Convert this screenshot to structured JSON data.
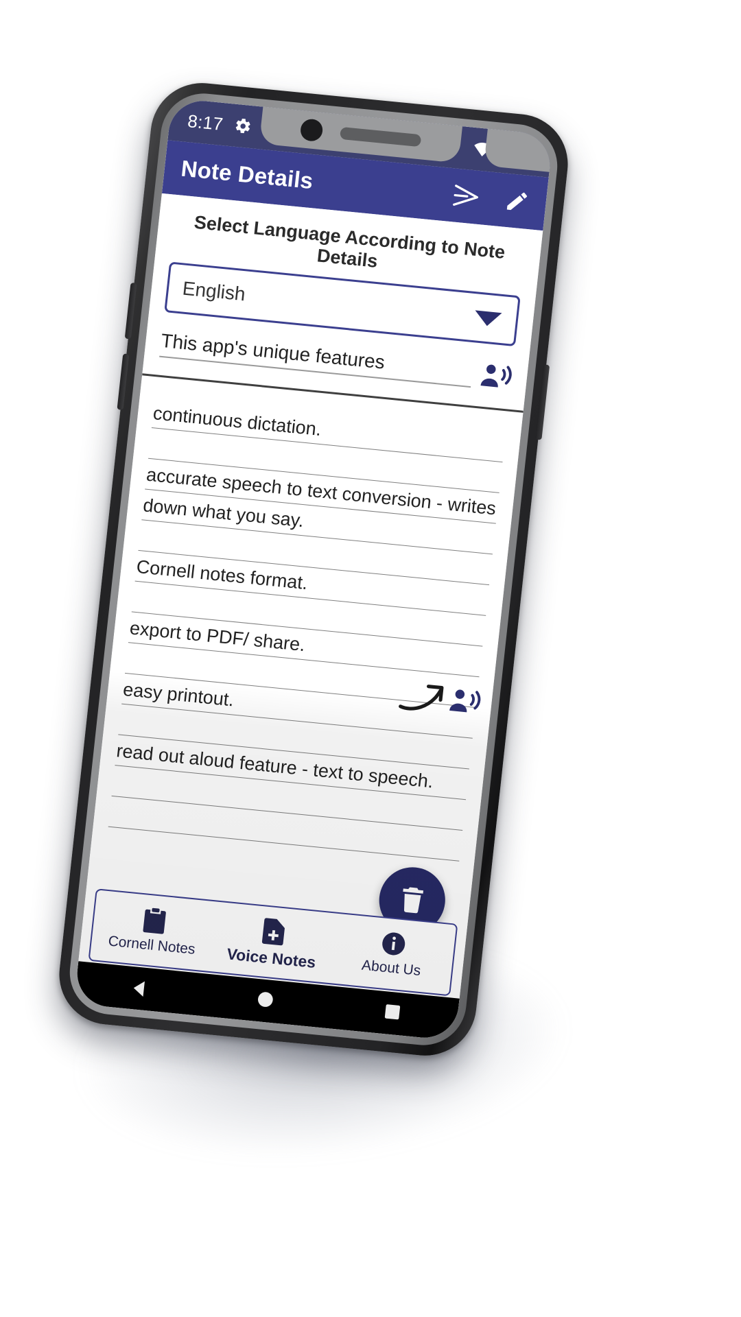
{
  "status_bar": {
    "time": "8:17",
    "left_icons": [
      "gear-icon",
      "sd-card-icon"
    ],
    "right_icons": [
      "wifi-icon",
      "signal-icon",
      "battery-icon"
    ]
  },
  "app_bar": {
    "title": "Note Details",
    "actions": [
      {
        "name": "send-icon",
        "label": "Send"
      },
      {
        "name": "edit-pencil-icon",
        "label": "Edit"
      }
    ]
  },
  "language": {
    "header": "Select Language According to Note Details",
    "selected": "English",
    "caret": "chevron-down-icon"
  },
  "note": {
    "title": "This app's unique features",
    "title_speaker_icon": "speaker-person-icon",
    "lines": [
      {
        "text": "continuous dictation.",
        "blank": false
      },
      {
        "text": "",
        "blank": true
      },
      {
        "text": "accurate speech to text conversion - writes",
        "blank": false
      },
      {
        "text": "down what you say.",
        "blank": false
      },
      {
        "text": "",
        "blank": true
      },
      {
        "text": "Cornell notes format.",
        "blank": false
      },
      {
        "text": "",
        "blank": true
      },
      {
        "text": "export to PDF/ share.",
        "blank": false
      },
      {
        "text": "",
        "blank": true
      },
      {
        "text": "easy printout.",
        "blank": false
      },
      {
        "text": "",
        "blank": true
      },
      {
        "text": "read out aloud feature - text to speech.",
        "blank": false
      },
      {
        "text": "",
        "blank": true
      },
      {
        "text": "",
        "blank": true
      }
    ],
    "read_aloud_marker": {
      "arrow_icon": "curved-arrow-icon",
      "speaker_icon": "speaker-person-icon"
    }
  },
  "fab": {
    "name": "delete-fab",
    "icon": "trash-icon",
    "color": "#272a66"
  },
  "bottom_nav": {
    "items": [
      {
        "label": "Cornell Notes",
        "icon": "clipboard-icon",
        "active": false
      },
      {
        "label": "Voice Notes",
        "icon": "note-add-icon",
        "active": true
      },
      {
        "label": "About Us",
        "icon": "info-icon",
        "active": false
      }
    ]
  },
  "system_nav": {
    "buttons": [
      "back-triangle-icon",
      "home-circle-icon",
      "recents-square-icon"
    ]
  },
  "colors": {
    "app_bar": "#3b3f8f",
    "status_bar": "#3c4070",
    "accent": "#272a66"
  }
}
